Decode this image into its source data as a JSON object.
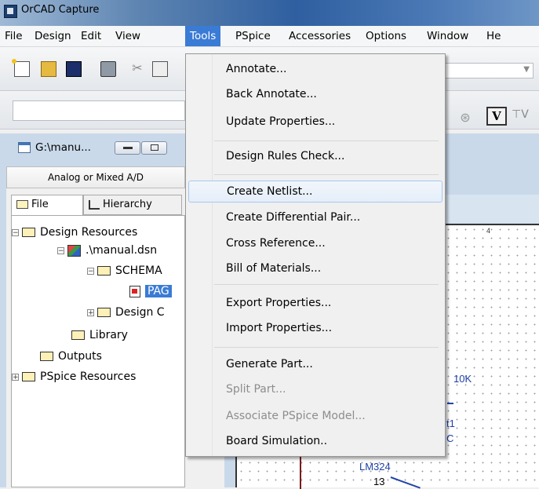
{
  "window": {
    "title": "OrCAD Capture"
  },
  "menubar": {
    "items": [
      "File",
      "Design",
      "Edit",
      "View",
      "Tools",
      "PSpice",
      "Accessories",
      "Options",
      "Window",
      "He"
    ]
  },
  "tools_menu": {
    "items": [
      {
        "label": "Annotate...",
        "enabled": true
      },
      {
        "label": "Back Annotate...",
        "enabled": true
      },
      {
        "label": "Update Properties...",
        "enabled": true
      },
      {
        "label": "Design Rules Check...",
        "enabled": true
      },
      {
        "label": "Create Netlist...",
        "enabled": true,
        "highlighted": true
      },
      {
        "label": "Create Differential Pair...",
        "enabled": true
      },
      {
        "label": "Cross Reference...",
        "enabled": true
      },
      {
        "label": "Bill of Materials...",
        "enabled": true
      },
      {
        "label": "Export Properties...",
        "enabled": true
      },
      {
        "label": "Import Properties...",
        "enabled": true
      },
      {
        "label": "Generate Part...",
        "enabled": true
      },
      {
        "label": "Split Part...",
        "enabled": false
      },
      {
        "label": "Associate PSpice Model...",
        "enabled": false
      },
      {
        "label": "Board Simulation..",
        "enabled": true
      }
    ]
  },
  "toolbar": {
    "voltage_marker": "V"
  },
  "project_window": {
    "title": "G:\\manu...",
    "context": "Analog or Mixed A/D",
    "tabs": [
      "File",
      "Hierarchy"
    ],
    "tree": [
      "Design Resources",
      ".\\manual.dsn",
      "SCHEMA",
      "PAG",
      "Design C",
      "Library",
      "Outputs",
      "PSpice Resources"
    ]
  },
  "schematic": {
    "ruler_mark": "4",
    "labels": [
      "10K",
      "t1",
      "C",
      "LM324",
      "13"
    ]
  },
  "colors": {
    "menu_highlight": "#3a7bd5",
    "schematic_text": "#1e3fa8"
  }
}
